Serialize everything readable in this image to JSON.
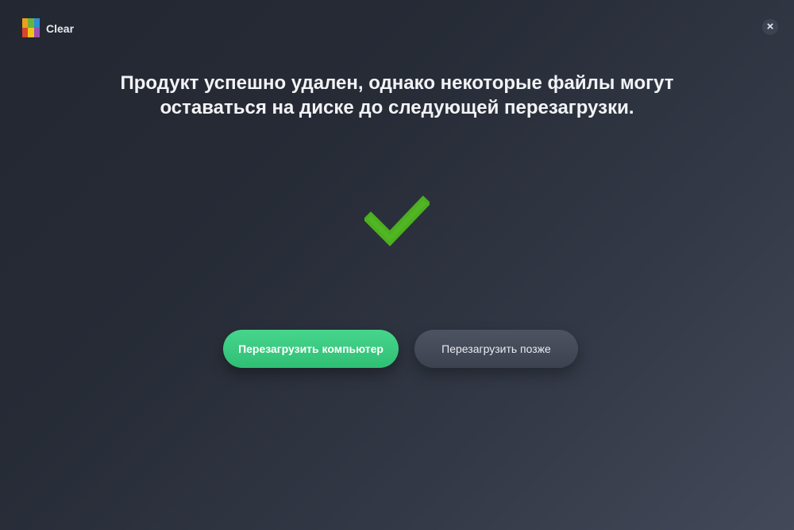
{
  "app": {
    "title": "Clear",
    "logo_icon": "avg-logo-icon",
    "close_icon": "close-icon"
  },
  "message": {
    "line1": "Продукт успешно удален, однако некоторые файлы могут",
    "line2": "оставаться на диске до следующей перезагрузки."
  },
  "status": {
    "icon": "checkmark-icon",
    "color": "#4caf1f"
  },
  "actions": {
    "restart_now": "Перезагрузить компьютер",
    "restart_later": "Перезагрузить позже"
  },
  "colors": {
    "background": "#262b36",
    "primary_button": "#3ccb80",
    "secondary_button": "#454b58"
  }
}
